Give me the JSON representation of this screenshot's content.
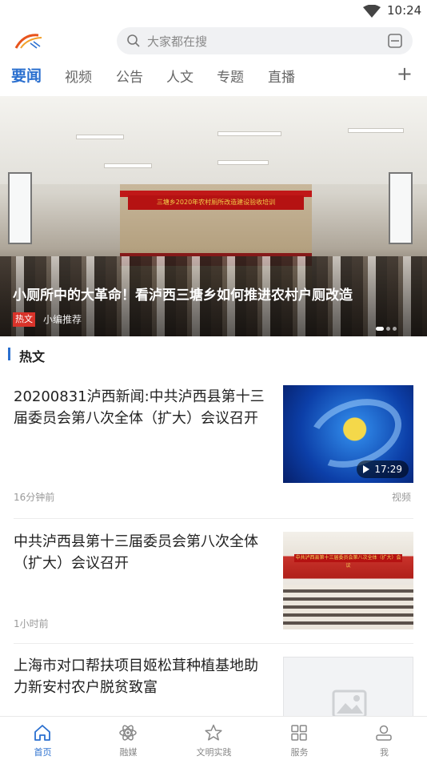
{
  "status_bar": {
    "time": "10:24"
  },
  "search": {
    "placeholder": "大家都在搜"
  },
  "tabs": [
    {
      "label": "要闻",
      "active": true
    },
    {
      "label": "视频"
    },
    {
      "label": "公告"
    },
    {
      "label": "人文"
    },
    {
      "label": "专题"
    },
    {
      "label": "直播"
    }
  ],
  "tab_add": "+",
  "banner": {
    "stage_text": "三塘乡2020年农村厕所改造建设验收培训",
    "title": "小厕所中的大革命！看泸西三塘乡如何推进农村户厕改造",
    "tag": "热文",
    "source": "小编推荐"
  },
  "section": {
    "title": "热文"
  },
  "news": [
    {
      "title": "20200831泸西新闻:中共泸西县第十三届委员会第八次全体（扩大）会议召开",
      "time": "16分钟前",
      "type": "视频",
      "duration": "17:29",
      "thumb": "video"
    },
    {
      "title": "中共泸西县第十三届委员会第八次全体（扩大）会议召开",
      "time": "1小时前",
      "type": "",
      "thumb_text": "中共泸西县第十三届委员会第八次全体（扩大）会议",
      "thumb": "meeting"
    },
    {
      "title": "上海市对口帮扶项目姬松茸种植基地助力新安村农户脱贫致富",
      "thumb": "placeholder"
    }
  ],
  "bottom_nav": [
    {
      "label": "首页",
      "icon": "home-icon",
      "active": true
    },
    {
      "label": "融媒",
      "icon": "atom-icon"
    },
    {
      "label": "文明实践",
      "icon": "star-icon"
    },
    {
      "label": "服务",
      "icon": "grid-icon"
    },
    {
      "label": "我",
      "icon": "user-icon"
    }
  ],
  "colors": {
    "accent": "#2a6fcf",
    "tag_red": "#d8332a"
  }
}
